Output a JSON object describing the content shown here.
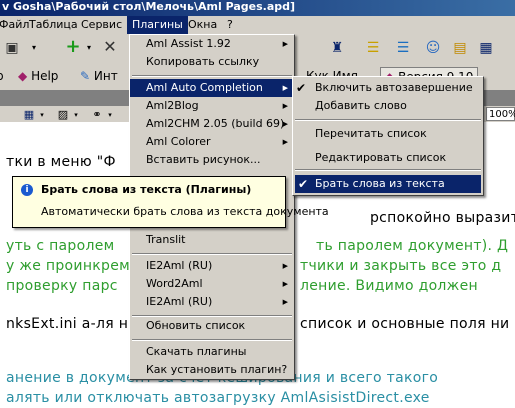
{
  "window": {
    "title": "v Gosha\\Рабочий стол\\Мелочь\\Aml Pages.apd]"
  },
  "menubar": {
    "items": [
      "Файл",
      "Таблица",
      "Сервис",
      "Плагины",
      "Окна",
      "?"
    ],
    "active": "Плагины"
  },
  "tabs": {
    "help": "Help",
    "int": "Инт",
    "version": "Версия 9.10",
    "kuk": "Кук Имя"
  },
  "zoom": "100%",
  "document": {
    "lines": [
      "тки в меню \"Ф",
      "рспокойно выразить без",
      "уть с паролем",
      "ть паролем документ). Д",
      "у же проинкрем",
      "тчики и закрыть все это д",
      "проверку парс",
      "ление. Видимо должен",
      "nksExt.ini а-ля н",
      "список и основные поля ни",
      "анение в документ за счет кеширования и всего такого",
      "алять или отключать автозагрузку AmlAsisistDirect.exe"
    ]
  },
  "plugins_menu": {
    "items": [
      {
        "label": "Aml Assist 1.92",
        "submenu": true
      },
      {
        "label": "Копировать ссылку",
        "submenu": false
      },
      {
        "label": "Aml Auto Completion",
        "submenu": true
      },
      {
        "label": "Aml2Blog",
        "submenu": true
      },
      {
        "label": "Aml2CHM 2.05 (build 69)",
        "submenu": true
      },
      {
        "label": "Aml Colorer",
        "submenu": true
      },
      {
        "label": "Вставить рисунок...",
        "submenu": false
      },
      {
        "label": "Translit",
        "submenu": false
      },
      {
        "label": "IE2Aml (RU)",
        "submenu": true
      },
      {
        "label": "Word2Aml",
        "submenu": true
      },
      {
        "label": "IE2Aml (RU)",
        "submenu": true
      },
      {
        "label": "Обновить список",
        "submenu": false
      },
      {
        "label": "Скачать плагины",
        "submenu": false
      },
      {
        "label": "Как установить плагин?",
        "submenu": false
      }
    ]
  },
  "autocompletion_menu": {
    "items": [
      {
        "label": "Включить автозавершение",
        "checked": true
      },
      {
        "label": "Добавить слово",
        "checked": false
      },
      {
        "label": "Перечитать список",
        "checked": false
      },
      {
        "label": "Редактировать список",
        "checked": false
      },
      {
        "label": "Брать слова из текста",
        "checked": true
      }
    ]
  },
  "tooltip": {
    "title": "Брать слова из текста (Плагины)",
    "body": "Автоматически брать слова из текста документа"
  },
  "colors": {
    "highlight": "#0a246a",
    "menu_bg": "#d4d0c8",
    "tooltip_bg": "#ffffe1",
    "green_text": "#2f9e2f",
    "teal_text": "#2a8fa4"
  }
}
